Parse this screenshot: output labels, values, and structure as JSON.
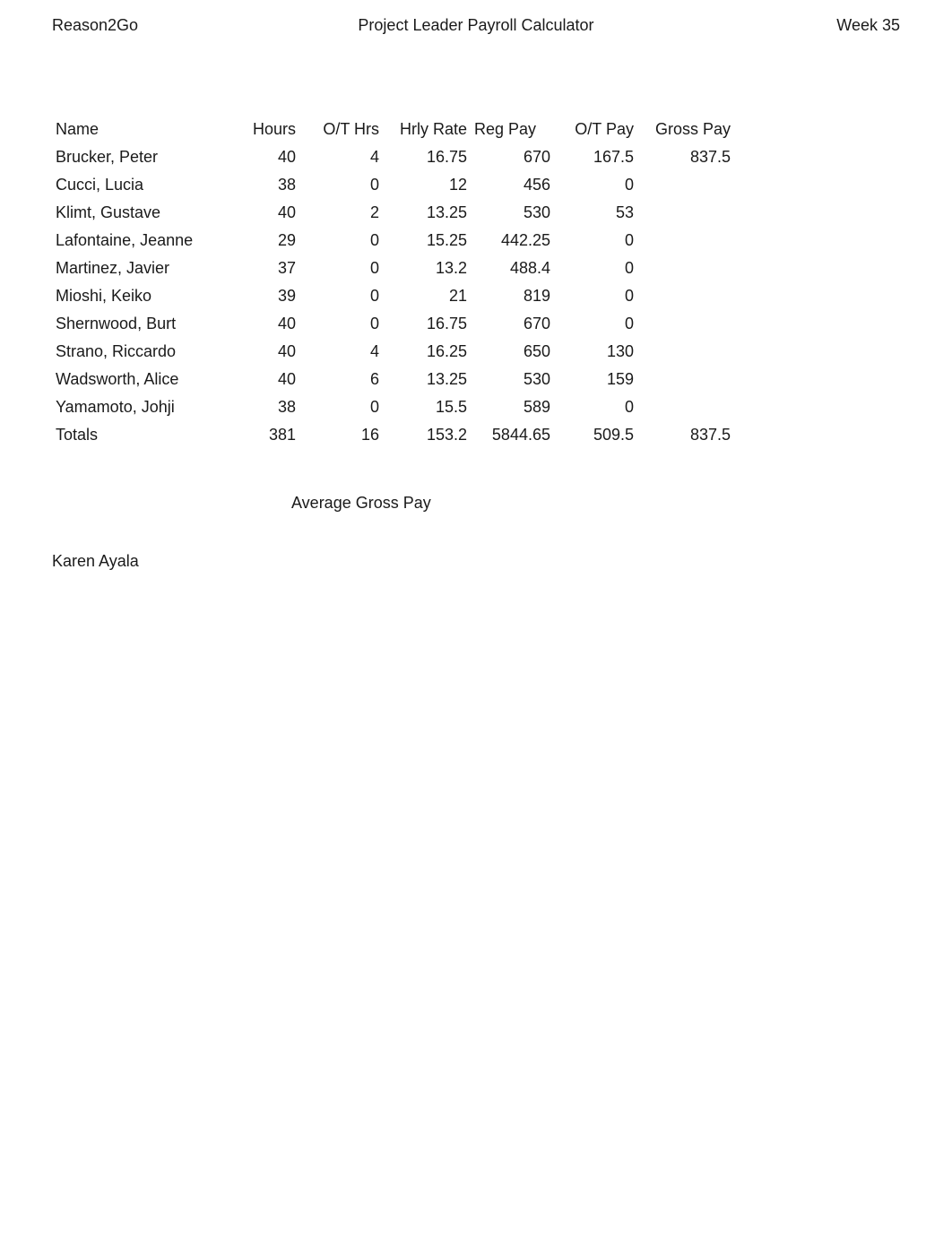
{
  "header": {
    "left": "Reason2Go",
    "center": "Project Leader Payroll Calculator",
    "right": "Week 35"
  },
  "columns": {
    "name": "Name",
    "hours": "Hours",
    "ot_hrs": "O/T Hrs",
    "hrly_rate": "Hrly Rate",
    "reg_pay": "Reg Pay",
    "ot_pay": "O/T Pay",
    "gross_pay": "Gross Pay"
  },
  "rows": [
    {
      "name": "Brucker, Peter",
      "hours": "40",
      "ot_hrs": "4",
      "hrly_rate": "16.75",
      "reg_pay": "670",
      "ot_pay": "167.5",
      "gross_pay": "837.5"
    },
    {
      "name": "Cucci, Lucia",
      "hours": "38",
      "ot_hrs": "0",
      "hrly_rate": "12",
      "reg_pay": "456",
      "ot_pay": "0",
      "gross_pay": ""
    },
    {
      "name": "Klimt, Gustave",
      "hours": "40",
      "ot_hrs": "2",
      "hrly_rate": "13.25",
      "reg_pay": "530",
      "ot_pay": "53",
      "gross_pay": ""
    },
    {
      "name": "Lafontaine, Jeanne",
      "hours": "29",
      "ot_hrs": "0",
      "hrly_rate": "15.25",
      "reg_pay": "442.25",
      "ot_pay": "0",
      "gross_pay": ""
    },
    {
      "name": "Martinez, Javier",
      "hours": "37",
      "ot_hrs": "0",
      "hrly_rate": "13.2",
      "reg_pay": "488.4",
      "ot_pay": "0",
      "gross_pay": ""
    },
    {
      "name": "Mioshi, Keiko",
      "hours": "39",
      "ot_hrs": "0",
      "hrly_rate": "21",
      "reg_pay": "819",
      "ot_pay": "0",
      "gross_pay": ""
    },
    {
      "name": "Shernwood, Burt",
      "hours": "40",
      "ot_hrs": "0",
      "hrly_rate": "16.75",
      "reg_pay": "670",
      "ot_pay": "0",
      "gross_pay": ""
    },
    {
      "name": "Strano, Riccardo",
      "hours": "40",
      "ot_hrs": "4",
      "hrly_rate": "16.25",
      "reg_pay": "650",
      "ot_pay": "130",
      "gross_pay": ""
    },
    {
      "name": "Wadsworth, Alice",
      "hours": "40",
      "ot_hrs": "6",
      "hrly_rate": "13.25",
      "reg_pay": "530",
      "ot_pay": "159",
      "gross_pay": ""
    },
    {
      "name": "Yamamoto, Johji",
      "hours": "38",
      "ot_hrs": "0",
      "hrly_rate": "15.5",
      "reg_pay": "589",
      "ot_pay": "0",
      "gross_pay": ""
    }
  ],
  "totals": {
    "name": "Totals",
    "hours": "381",
    "ot_hrs": "16",
    "hrly_rate": "153.2",
    "reg_pay": "5844.65",
    "ot_pay": "509.5",
    "gross_pay": "837.5"
  },
  "average_label": "Average Gross Pay",
  "author": "Karen Ayala"
}
